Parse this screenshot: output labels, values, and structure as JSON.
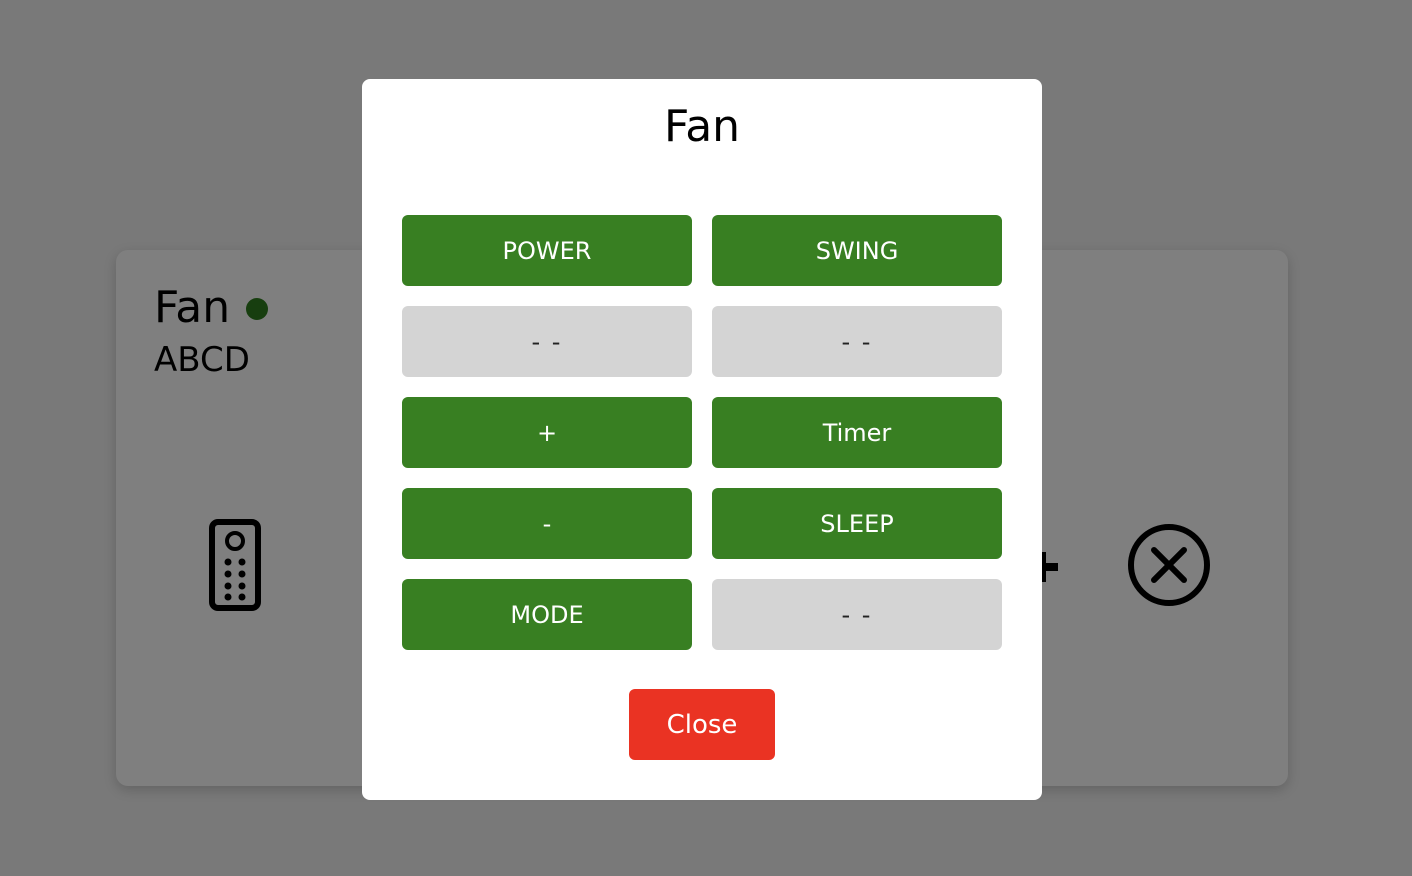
{
  "device": {
    "name": "Fan",
    "code": "ABCD",
    "status_color": "#2e7d1e",
    "remote_icon": "remote-control-icon",
    "remove_icon": "remove-circle-icon"
  },
  "modal": {
    "title": "Fan",
    "buttons": [
      {
        "label": "POWER",
        "state": "active"
      },
      {
        "label": "SWING",
        "state": "active"
      },
      {
        "label": "- -",
        "state": "empty"
      },
      {
        "label": "- -",
        "state": "empty"
      },
      {
        "label": "+",
        "state": "active"
      },
      {
        "label": "Timer",
        "state": "active"
      },
      {
        "label": "-",
        "state": "active"
      },
      {
        "label": "SLEEP",
        "state": "active"
      },
      {
        "label": "MODE",
        "state": "active"
      },
      {
        "label": "- -",
        "state": "empty"
      }
    ],
    "close_label": "Close",
    "colors": {
      "active": "#387f22",
      "empty": "#d4d4d4",
      "close": "#ea3323"
    }
  }
}
